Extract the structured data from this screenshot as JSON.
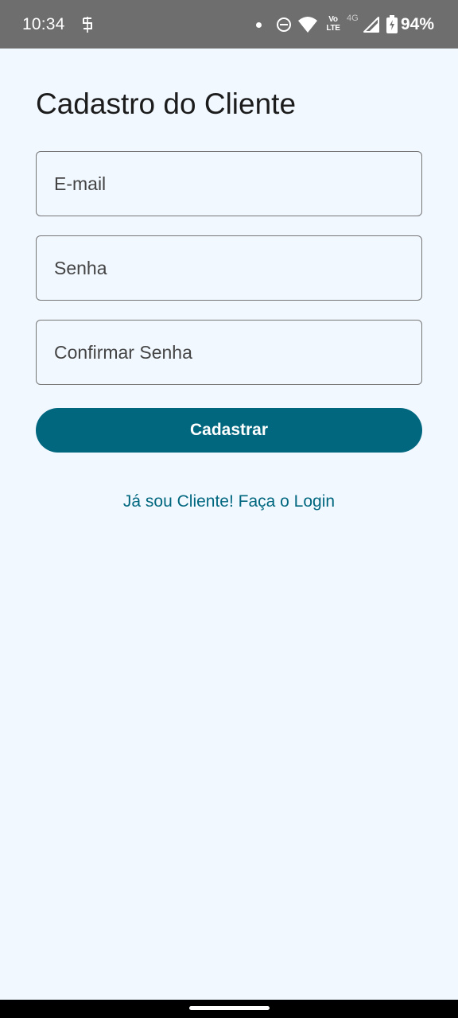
{
  "status_bar": {
    "time": "10:34",
    "volte_top": "Vo",
    "volte_bottom": "LTE",
    "network": "4G",
    "battery": "94%",
    "icons": [
      "app-notification-icon",
      "dot-icon",
      "do-not-disturb-icon",
      "wifi-icon",
      "volte-icon",
      "network-4g-icon",
      "signal-icon",
      "battery-charging-icon"
    ]
  },
  "screen": {
    "title": "Cadastro do Cliente",
    "fields": {
      "email_placeholder": "E-mail",
      "email_value": "",
      "password_placeholder": "Senha",
      "password_value": "",
      "confirm_placeholder": "Confirmar Senha",
      "confirm_value": ""
    },
    "submit_label": "Cadastrar",
    "login_link": "Já sou Cliente! Faça o Login"
  },
  "colors": {
    "background": "#f1f8ff",
    "status_bar": "#6e6e6e",
    "primary": "#00677f",
    "title_text": "#1c1c1c",
    "field_border": "#767676"
  }
}
